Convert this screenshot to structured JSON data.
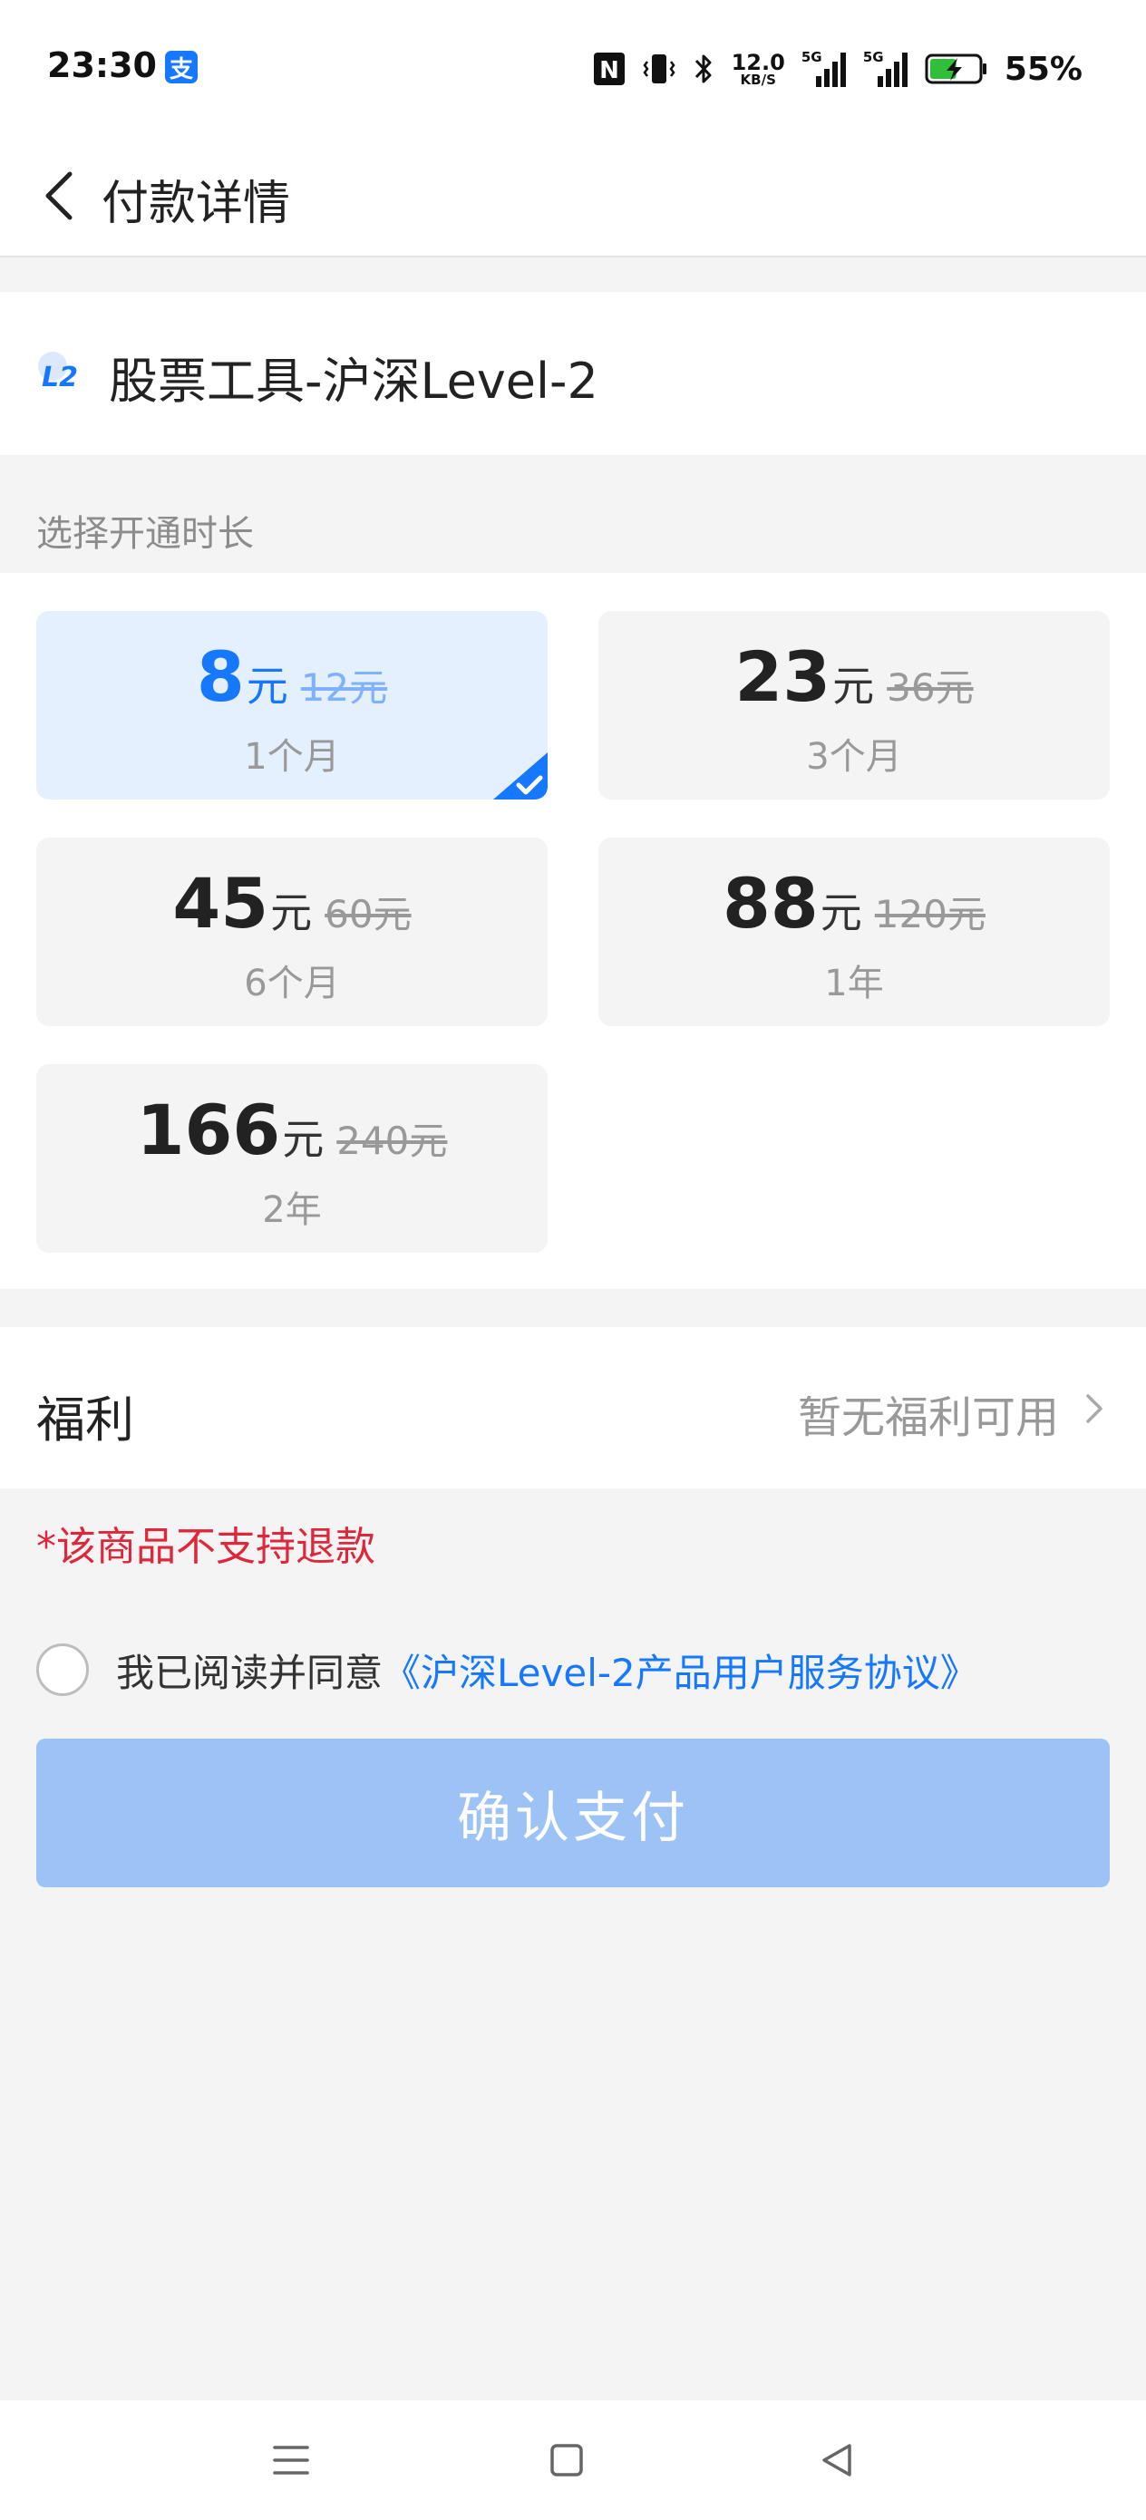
{
  "status_bar": {
    "time": "23:30",
    "alipay_badge": "支",
    "nfc_label": "N",
    "net_speed_value": "12.0",
    "net_speed_unit": "KB/S",
    "signal_1_label": "5G",
    "signal_2_label": "5G",
    "battery_percent": "55%",
    "battery_level": 0.55
  },
  "header": {
    "title": "付款详情"
  },
  "product": {
    "icon_label": "L2",
    "title": "股票工具-沪深Level-2"
  },
  "duration_section": {
    "label": "选择开通时长"
  },
  "plans": [
    {
      "price": "8",
      "unit": "元",
      "original": "12元",
      "duration": "1个月",
      "selected": true
    },
    {
      "price": "23",
      "unit": "元",
      "original": "36元",
      "duration": "3个月",
      "selected": false
    },
    {
      "price": "45",
      "unit": "元",
      "original": "60元",
      "duration": "6个月",
      "selected": false
    },
    {
      "price": "88",
      "unit": "元",
      "original": "120元",
      "duration": "1年",
      "selected": false
    },
    {
      "price": "166",
      "unit": "元",
      "original": "240元",
      "duration": "2年",
      "selected": false
    }
  ],
  "benefits": {
    "label": "福利",
    "value": "暂无福利可用"
  },
  "refund_note": "*该商品不支持退款",
  "agreement": {
    "prefix": "我已阅读并同意",
    "link": "《沪深Level-2产品用户服务协议》",
    "checked": false
  },
  "confirm_button": {
    "label": "确认支付"
  },
  "colors": {
    "accent": "#1677ff",
    "selected_card_bg": "#e5f0ff",
    "button_disabled": "#9dc2f6",
    "warning_red": "#e0263a"
  },
  "nav_bar": {
    "icons": [
      "menu-icon",
      "home-square-icon",
      "back-triangle-icon"
    ]
  }
}
